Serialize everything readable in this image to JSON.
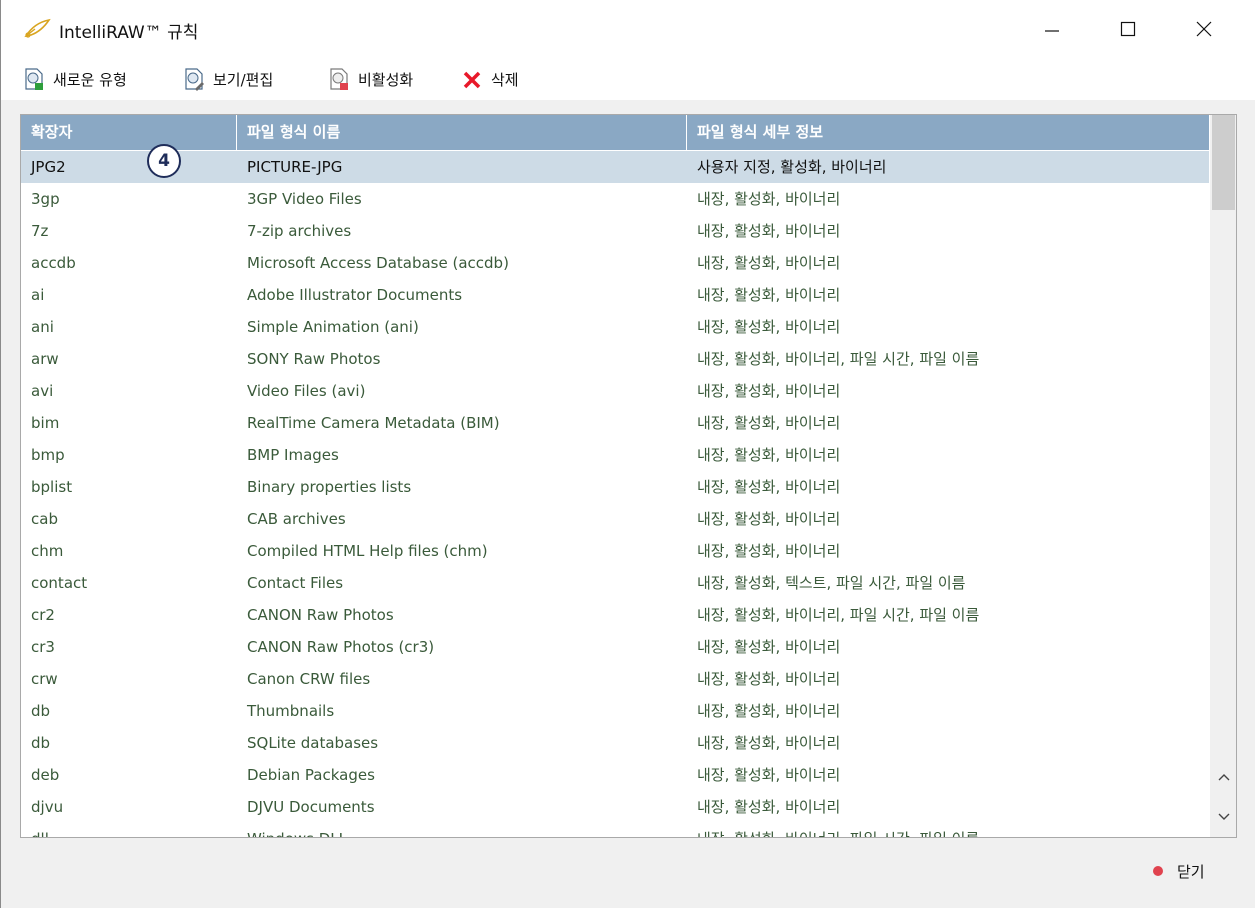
{
  "window": {
    "title": "IntelliRAW™ 규칙"
  },
  "toolbar": {
    "new_type": "새로운 유형",
    "view_edit": "보기/편집",
    "deactivate": "비활성화",
    "delete": "삭제"
  },
  "table": {
    "columns": [
      "확장자",
      "파일 형식 이름",
      "파일 형식 세부 정보"
    ],
    "rows": [
      {
        "ext": "JPG2",
        "name": "PICTURE-JPG",
        "details": "사용자 지정, 활성화, 바이너리"
      },
      {
        "ext": "3gp",
        "name": "3GP Video Files",
        "details": "내장, 활성화, 바이너리"
      },
      {
        "ext": "7z",
        "name": "7-zip archives",
        "details": "내장, 활성화, 바이너리"
      },
      {
        "ext": "accdb",
        "name": "Microsoft Access Database (accdb)",
        "details": "내장, 활성화, 바이너리"
      },
      {
        "ext": "ai",
        "name": "Adobe Illustrator Documents",
        "details": "내장, 활성화, 바이너리"
      },
      {
        "ext": "ani",
        "name": "Simple Animation (ani)",
        "details": "내장, 활성화, 바이너리"
      },
      {
        "ext": "arw",
        "name": "SONY Raw Photos",
        "details": "내장, 활성화, 바이너리, 파일 시간, 파일 이름"
      },
      {
        "ext": "avi",
        "name": "Video Files (avi)",
        "details": "내장, 활성화, 바이너리"
      },
      {
        "ext": "bim",
        "name": "RealTime Camera Metadata (BIM)",
        "details": "내장, 활성화, 바이너리"
      },
      {
        "ext": "bmp",
        "name": "BMP Images",
        "details": "내장, 활성화, 바이너리"
      },
      {
        "ext": "bplist",
        "name": "Binary properties lists",
        "details": "내장, 활성화, 바이너리"
      },
      {
        "ext": "cab",
        "name": "CAB archives",
        "details": "내장, 활성화, 바이너리"
      },
      {
        "ext": "chm",
        "name": "Compiled HTML Help files (chm)",
        "details": "내장, 활성화, 바이너리"
      },
      {
        "ext": "contact",
        "name": "Contact Files",
        "details": "내장, 활성화, 텍스트, 파일 시간, 파일 이름"
      },
      {
        "ext": "cr2",
        "name": "CANON Raw Photos",
        "details": "내장, 활성화, 바이너리, 파일 시간, 파일 이름"
      },
      {
        "ext": "cr3",
        "name": "CANON Raw Photos (cr3)",
        "details": "내장, 활성화, 바이너리"
      },
      {
        "ext": "crw",
        "name": "Canon CRW files",
        "details": "내장, 활성화, 바이너리"
      },
      {
        "ext": "db",
        "name": "Thumbnails",
        "details": "내장, 활성화, 바이너리"
      },
      {
        "ext": "db",
        "name": "SQLite databases",
        "details": "내장, 활성화, 바이너리"
      },
      {
        "ext": "deb",
        "name": "Debian Packages",
        "details": "내장, 활성화, 바이너리"
      },
      {
        "ext": "djvu",
        "name": "DJVU Documents",
        "details": "내장, 활성화, 바이너리"
      },
      {
        "ext": "dll",
        "name": "Windows DLL",
        "details": "내장, 활성화, 바이너리, 파일 시간, 파일 이름"
      }
    ]
  },
  "annotation": {
    "badge": "4"
  },
  "footer": {
    "close_label": "닫기"
  },
  "colors": {
    "header_bg": "#8aa8c4",
    "selected_row": "#cddbe6",
    "row_text": "#3a5a3a",
    "close_dot": "#e0424e",
    "delete_x": "#e8182a"
  }
}
